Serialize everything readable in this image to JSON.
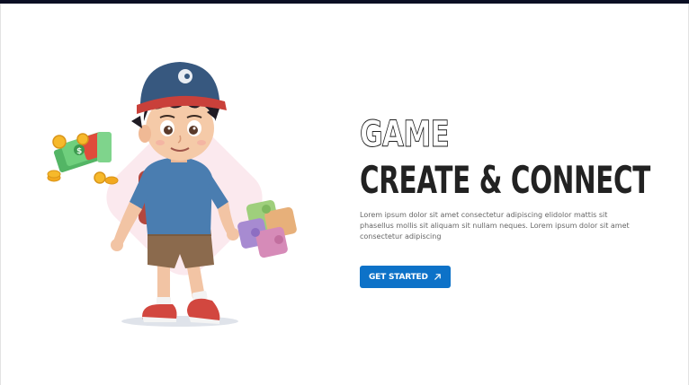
{
  "hero": {
    "eyebrow": "GAME",
    "title": "CREATE & CONNECT",
    "description": "Lorem ipsum dolor sit amet consectetur adipiscing elidolor mattis sit phasellus mollis sit aliquam sit nullam neques. Lorem ipsum dolor sit amet consectetur adipiscing",
    "cta_label": "GET STARTED",
    "cta_icon": "arrow-up-right-icon",
    "illustration": "boy-with-cap-holding-puzzle-and-money"
  },
  "colors": {
    "top_bar": "#0b0f24",
    "heading": "#222222",
    "body_text": "#666666",
    "cta_background": "#0d72c8",
    "cta_text": "#ffffff",
    "decor_blob": "#fbe9ee"
  }
}
